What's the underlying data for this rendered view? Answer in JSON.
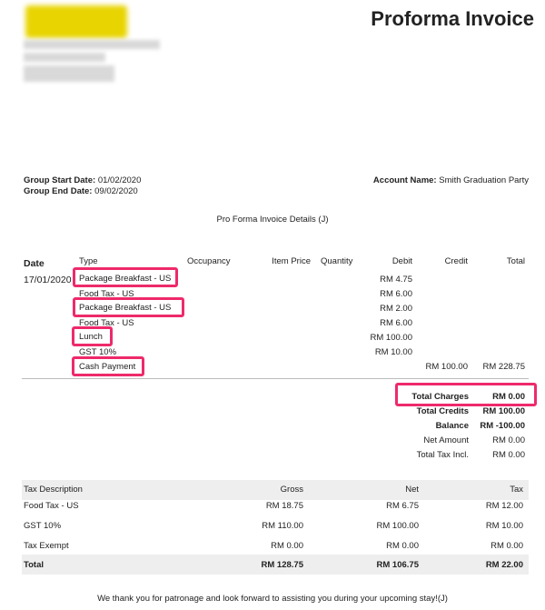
{
  "header": {
    "title": "Proforma Invoice"
  },
  "group": {
    "start_label": "Group Start Date:",
    "start_value": "01/02/2020",
    "end_label": "Group End Date:",
    "end_value": "09/02/2020",
    "account_label": "Account Name:",
    "account_value": "Smith Graduation Party"
  },
  "section_title": "Pro Forma Invoice Details (J)",
  "items_table": {
    "columns": [
      "Date",
      "Type",
      "Occupancy",
      "Item Price",
      "Quantity",
      "Debit",
      "Credit",
      "Total"
    ],
    "date": "17/01/2020",
    "rows": [
      {
        "type": "Package Breakfast - US",
        "debit": "RM 4.75",
        "credit": "",
        "total": ""
      },
      {
        "type": "Food Tax - US",
        "debit": "RM 6.00",
        "credit": "",
        "total": ""
      },
      {
        "type": "Package Breakfast - US",
        "debit": "RM 2.00",
        "credit": "",
        "total": ""
      },
      {
        "type": "Food Tax - US",
        "debit": "RM 6.00",
        "credit": "",
        "total": ""
      },
      {
        "type": "Lunch",
        "debit": "RM 100.00",
        "credit": "",
        "total": ""
      },
      {
        "type": "GST 10%",
        "debit": "RM 10.00",
        "credit": "",
        "total": ""
      },
      {
        "type": "Cash Payment",
        "debit": "",
        "credit": "RM 100.00",
        "total": "RM 228.75"
      }
    ]
  },
  "summary": [
    {
      "label": "Total Charges",
      "value": "RM 0.00",
      "bold": true
    },
    {
      "label": "Total Credits",
      "value": "RM 100.00",
      "bold": true
    },
    {
      "label": "Balance",
      "value": "RM -100.00",
      "bold": true
    },
    {
      "label": "Net Amount",
      "value": "RM 0.00",
      "bold": false
    },
    {
      "label": "Total Tax Incl.",
      "value": "RM 0.00",
      "bold": false
    }
  ],
  "tax_table": {
    "columns": [
      "Tax Description",
      "Gross",
      "Net",
      "Tax"
    ],
    "rows": [
      {
        "desc": "Food Tax - US",
        "gross": "RM 18.75",
        "net": "RM 6.75",
        "tax": "RM 12.00"
      },
      {
        "desc": "GST 10%",
        "gross": "RM 110.00",
        "net": "RM 100.00",
        "tax": "RM 10.00"
      },
      {
        "desc": "Tax Exempt",
        "gross": "RM 0.00",
        "net": "RM 0.00",
        "tax": "RM 0.00"
      }
    ],
    "total": {
      "desc": "Total",
      "gross": "RM 128.75",
      "net": "RM 106.75",
      "tax": "RM 22.00"
    }
  },
  "footer": "We thank you for patronage and look forward to assisting you during your upcoming stay!(J)",
  "colors": {
    "highlight": "#ee2a6b",
    "logo": "#e8d400"
  }
}
